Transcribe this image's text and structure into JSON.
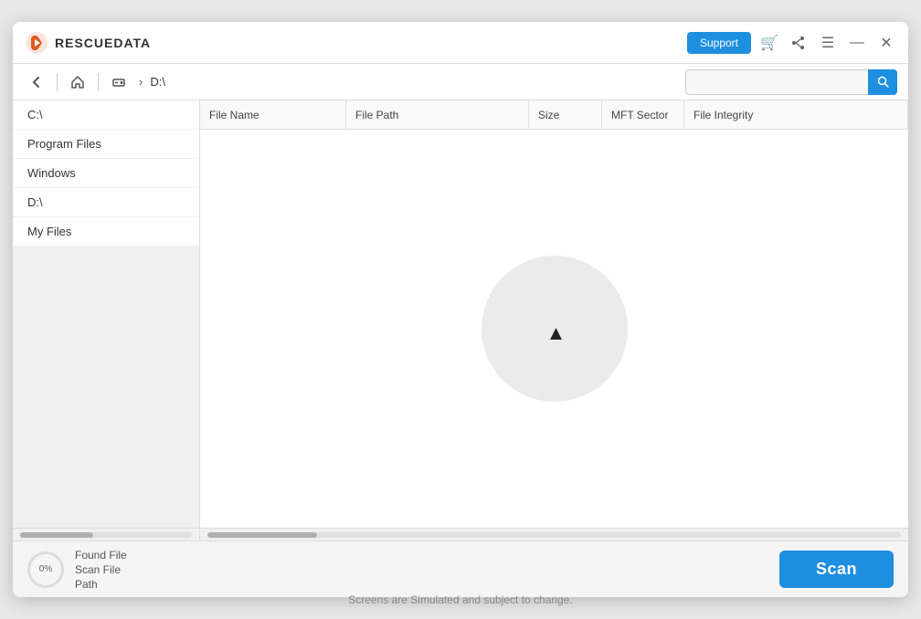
{
  "app": {
    "title": "RESCUEDATA",
    "logo_color": "#e05a1e",
    "footer_text": "Screens are Simulated and subject to change."
  },
  "titlebar": {
    "support_label": "Support",
    "cart_icon": "🛒",
    "share_icon": "◁",
    "menu_icon": "☰",
    "minimize_icon": "—",
    "close_icon": "✕"
  },
  "toolbar": {
    "back_icon": "↩",
    "home_icon": "⌂",
    "drive_icon": "💾",
    "breadcrumb": "D:\\",
    "search_placeholder": ""
  },
  "left_panel": {
    "items": [
      {
        "label": "C:\\"
      },
      {
        "label": "Program Files"
      },
      {
        "label": "Windows"
      },
      {
        "label": "D:\\"
      },
      {
        "label": "My Files"
      }
    ]
  },
  "table": {
    "columns": [
      {
        "id": "filename",
        "label": "File Name"
      },
      {
        "id": "filepath",
        "label": "File Path"
      },
      {
        "id": "size",
        "label": "Size"
      },
      {
        "id": "mft",
        "label": "MFT Sector"
      },
      {
        "id": "integrity",
        "label": "File Integrity"
      }
    ],
    "rows": []
  },
  "status": {
    "percent": "0%",
    "line1": "Found File",
    "line2": "Scan File",
    "line3": "Path"
  },
  "scan_button": {
    "label": "Scan"
  }
}
